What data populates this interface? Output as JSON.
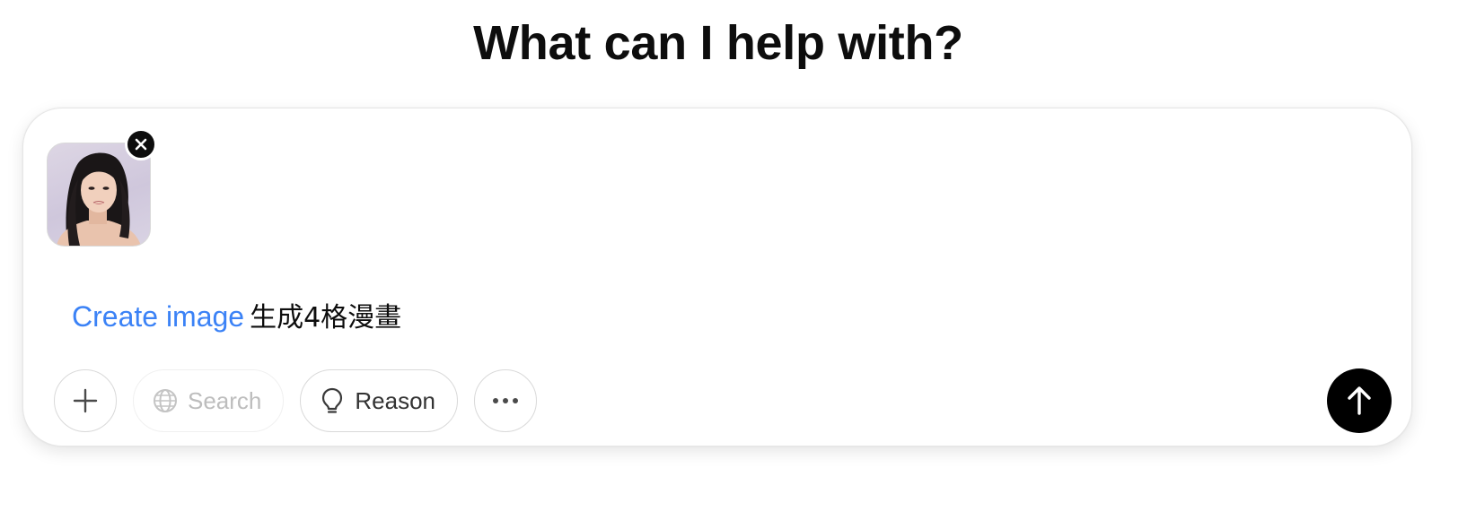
{
  "header": {
    "title": "What can I help with?"
  },
  "composer": {
    "attachment": {
      "kind": "image",
      "remove_icon": "close-icon"
    },
    "prompt": {
      "tool_label": "Create image",
      "text": "生成4格漫畫"
    },
    "toolbar": {
      "add_icon": "plus-icon",
      "search_label": "Search",
      "search_icon": "globe-icon",
      "reason_label": "Reason",
      "reason_icon": "lightbulb-icon",
      "more_icon": "ellipsis-icon"
    },
    "send_icon": "arrow-up-icon"
  },
  "colors": {
    "tool_label": "#3b82f6",
    "send_button": "#000000",
    "disabled_text": "#bdbdbd"
  }
}
